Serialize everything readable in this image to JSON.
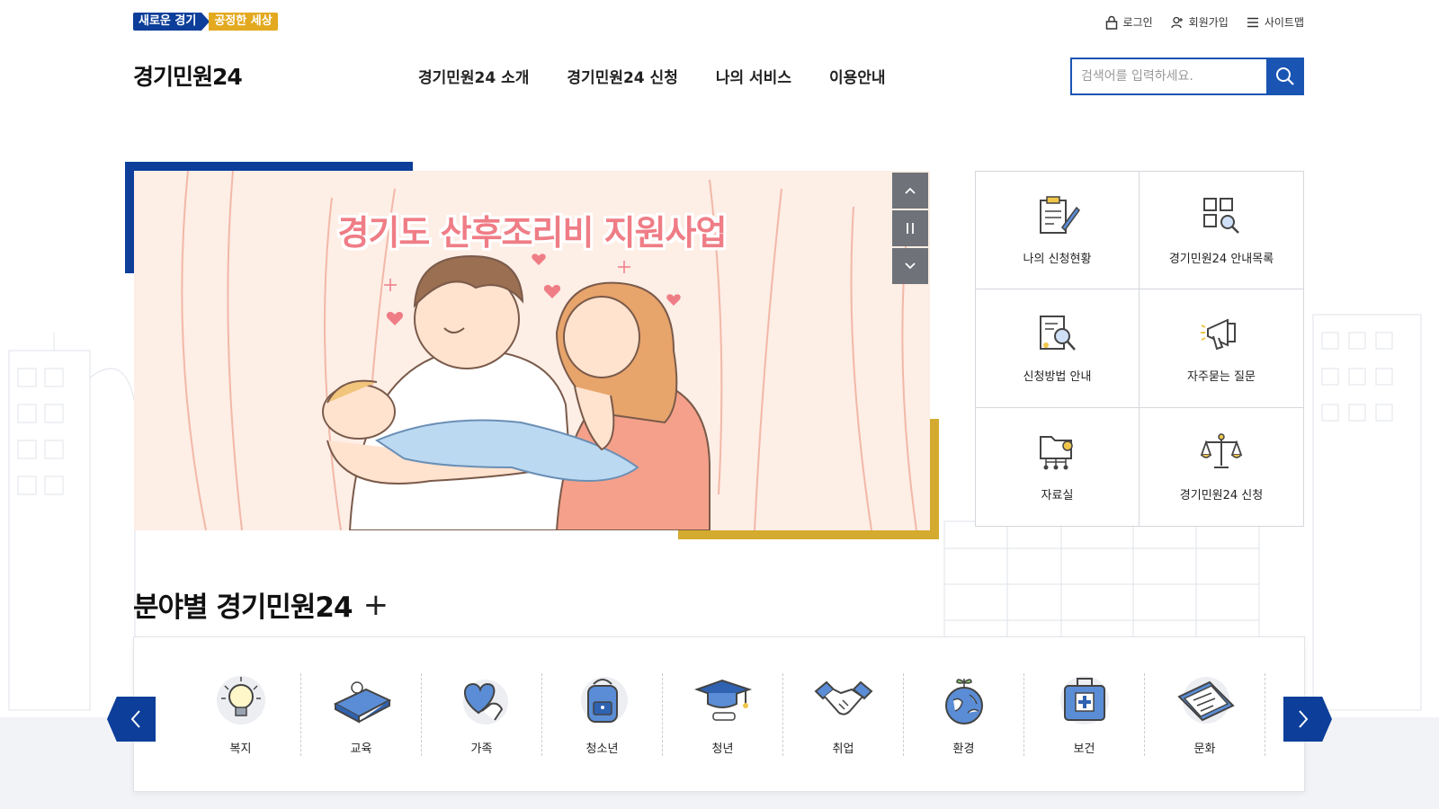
{
  "header": {
    "slogan_part1": "새로운 경기",
    "slogan_part2": "공정한 세상",
    "logo": "경기민원24",
    "util": {
      "login": "로그인",
      "join": "회원가입",
      "sitemap": "사이트맵"
    },
    "nav": [
      "경기민원24 소개",
      "경기민원24 신청",
      "나의 서비스",
      "이용안내"
    ],
    "search": {
      "placeholder": "검색어를 입력하세요."
    }
  },
  "banner": {
    "title": "경기도 산후조리비 지원사업",
    "controls": {
      "up": "up",
      "pause": "pause",
      "down": "down"
    }
  },
  "quick_menu": [
    {
      "label": "나의 신청현황",
      "icon": "clipboard-pen-icon"
    },
    {
      "label": "경기민원24 안내목록",
      "icon": "grid-search-icon"
    },
    {
      "label": "신청방법 안내",
      "icon": "document-magnifier-icon"
    },
    {
      "label": "자주묻는 질문",
      "icon": "megaphone-icon"
    },
    {
      "label": "자료실",
      "icon": "folder-network-icon"
    },
    {
      "label": "경기민원24 신청",
      "icon": "scales-icon"
    }
  ],
  "field_section": {
    "title": "분야별 경기민원24",
    "plus": "+",
    "items": [
      {
        "label": "복지",
        "icon": "lightbulb-icon"
      },
      {
        "label": "교육",
        "icon": "book-apple-icon"
      },
      {
        "label": "가족",
        "icon": "heart-hand-icon"
      },
      {
        "label": "청소년",
        "icon": "backpack-icon"
      },
      {
        "label": "청년",
        "icon": "graduation-cap-icon"
      },
      {
        "label": "취업",
        "icon": "handshake-icon"
      },
      {
        "label": "환경",
        "icon": "globe-sprout-icon"
      },
      {
        "label": "보건",
        "icon": "medical-kit-icon"
      },
      {
        "label": "문화",
        "icon": "ticket-icon"
      }
    ]
  },
  "colors": {
    "primary": "#0c3e9a",
    "accent_blue": "#1a55b3",
    "gold": "#d4ab2e",
    "banner_text": "#ef7d86"
  }
}
